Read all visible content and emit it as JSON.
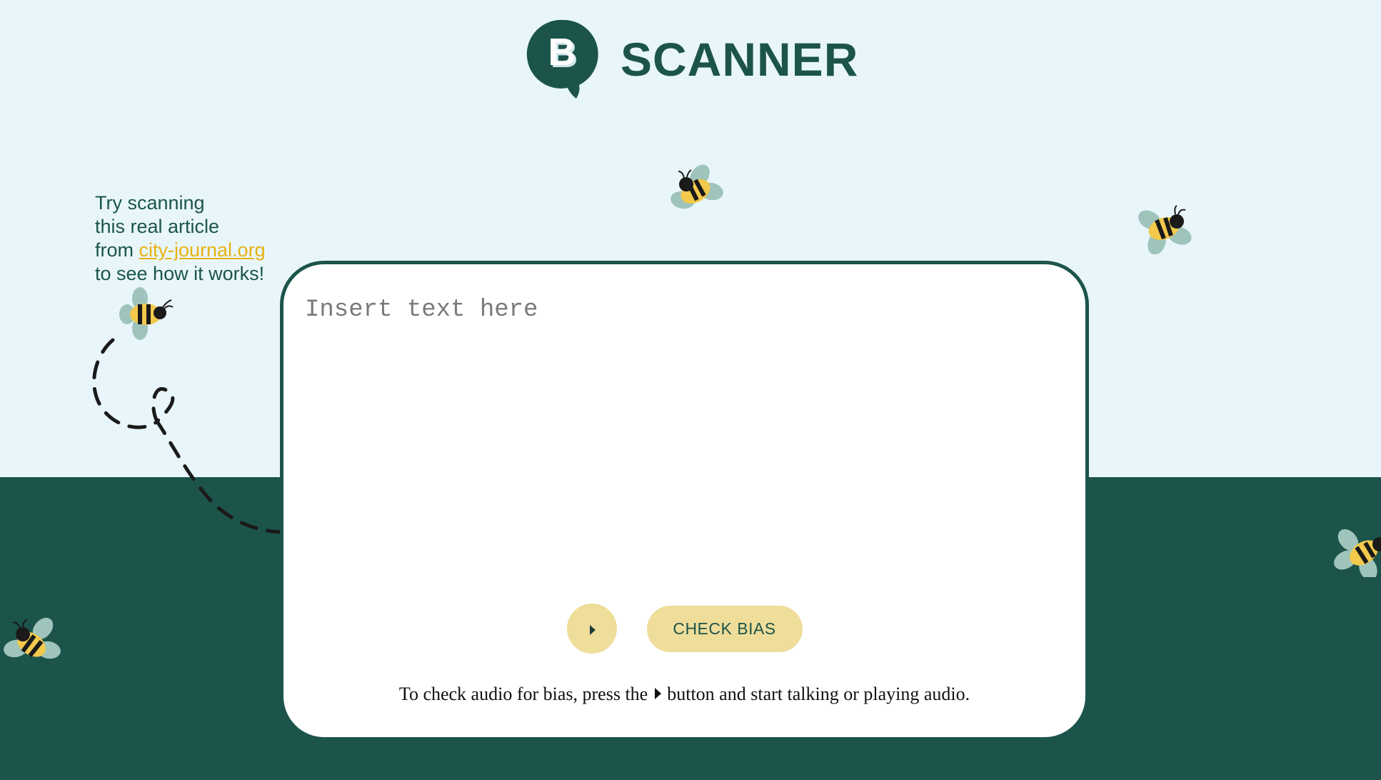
{
  "brand": {
    "logo_letter": "B",
    "name": "SCANNER",
    "primary_color": "#1c544b",
    "accent_color": "#efdd9a",
    "sky_color": "#e8f6fc"
  },
  "hint": {
    "line1": "Try scanning",
    "line2": "this real article",
    "line3_prefix": "from ",
    "link_text": "city-journal.org",
    "line4": "to see how it works!"
  },
  "scanner": {
    "placeholder": "Insert text here",
    "value": "",
    "play_icon": "play-icon",
    "check_label": "CHECK BIAS",
    "help_before": "To check audio for bias, press the",
    "help_after": "button and start talking or playing audio."
  }
}
